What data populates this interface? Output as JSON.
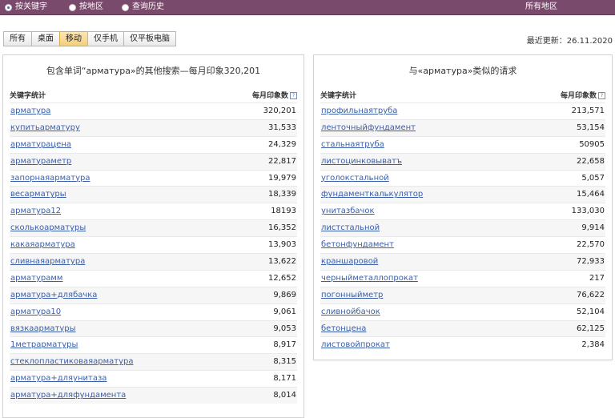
{
  "search_modes": [
    {
      "label": "按关键字",
      "checked": true
    },
    {
      "label": "按地区",
      "checked": false
    },
    {
      "label": "查询历史",
      "checked": false
    }
  ],
  "region_label": "所有地区",
  "tabs": [
    {
      "label": "所有",
      "active": false
    },
    {
      "label": "桌面",
      "active": false
    },
    {
      "label": "移动",
      "active": true
    },
    {
      "label": "仅手机",
      "active": false
    },
    {
      "label": "仅平板电脑",
      "active": false
    }
  ],
  "updated": "最近更新：26.11.2020",
  "left_panel": {
    "title": "包含单词“арматура»的其他搜索—每月印象320,201",
    "col_keyword": "关键字统计",
    "col_count": "每月印象数",
    "rows": [
      {
        "kw": "арматура",
        "count": "320,201"
      },
      {
        "kw": "купитьарматуру",
        "count": "31,533"
      },
      {
        "kw": "арматурацена",
        "count": "24,329"
      },
      {
        "kw": "арматураметр",
        "count": "22,817"
      },
      {
        "kw": "запорнаяарматура",
        "count": "19,979"
      },
      {
        "kw": "весарматуры",
        "count": "18,339"
      },
      {
        "kw": "арматура12",
        "count": "18193"
      },
      {
        "kw": "сколькоарматуры",
        "count": "16,352"
      },
      {
        "kw": "какаяарматура",
        "count": "13,903"
      },
      {
        "kw": "сливнаяарматура",
        "count": "13,622"
      },
      {
        "kw": "арматурамм",
        "count": "12,652"
      },
      {
        "kw": "арматура+длябачка",
        "count": "9,869"
      },
      {
        "kw": "арматура10",
        "count": "9,061"
      },
      {
        "kw": "вязкаарматуры",
        "count": "9,053"
      },
      {
        "kw": "1метрарматуры",
        "count": "8,917"
      },
      {
        "kw": "стеклопластиковаяарматура",
        "count": "8,315"
      },
      {
        "kw": "арматура+дляунитаза",
        "count": "8,171"
      },
      {
        "kw": "арматура+дляфундамента",
        "count": "8,014"
      }
    ]
  },
  "right_panel": {
    "title": "与«арматура»类似的请求",
    "col_keyword": "关键字统计",
    "col_count": "每月印象数",
    "rows": [
      {
        "kw": "профильнаятруба",
        "count": "213,571"
      },
      {
        "kw": "ленточныйфундамент",
        "count": "53,154"
      },
      {
        "kw": "стальнаятруба",
        "count": "50905"
      },
      {
        "kw": "листоцинковыватъ",
        "count": "22,658"
      },
      {
        "kw": "уголокстальной",
        "count": "5,057"
      },
      {
        "kw": "фундаменткалькулятор",
        "count": "15,464"
      },
      {
        "kw": "унитазбачок",
        "count": "133,030"
      },
      {
        "kw": "листстальной",
        "count": "9,914"
      },
      {
        "kw": "бетонфундамент",
        "count": "22,570"
      },
      {
        "kw": "краншаровой",
        "count": "72,933"
      },
      {
        "kw": "черныйметаллопрокат",
        "count": "217"
      },
      {
        "kw": "погонныйметр",
        "count": "76,622"
      },
      {
        "kw": "сливнойбачок",
        "count": "52,104"
      },
      {
        "kw": "бетонцена",
        "count": "62,125"
      },
      {
        "kw": "листовойпрокат",
        "count": "2,384"
      }
    ]
  }
}
